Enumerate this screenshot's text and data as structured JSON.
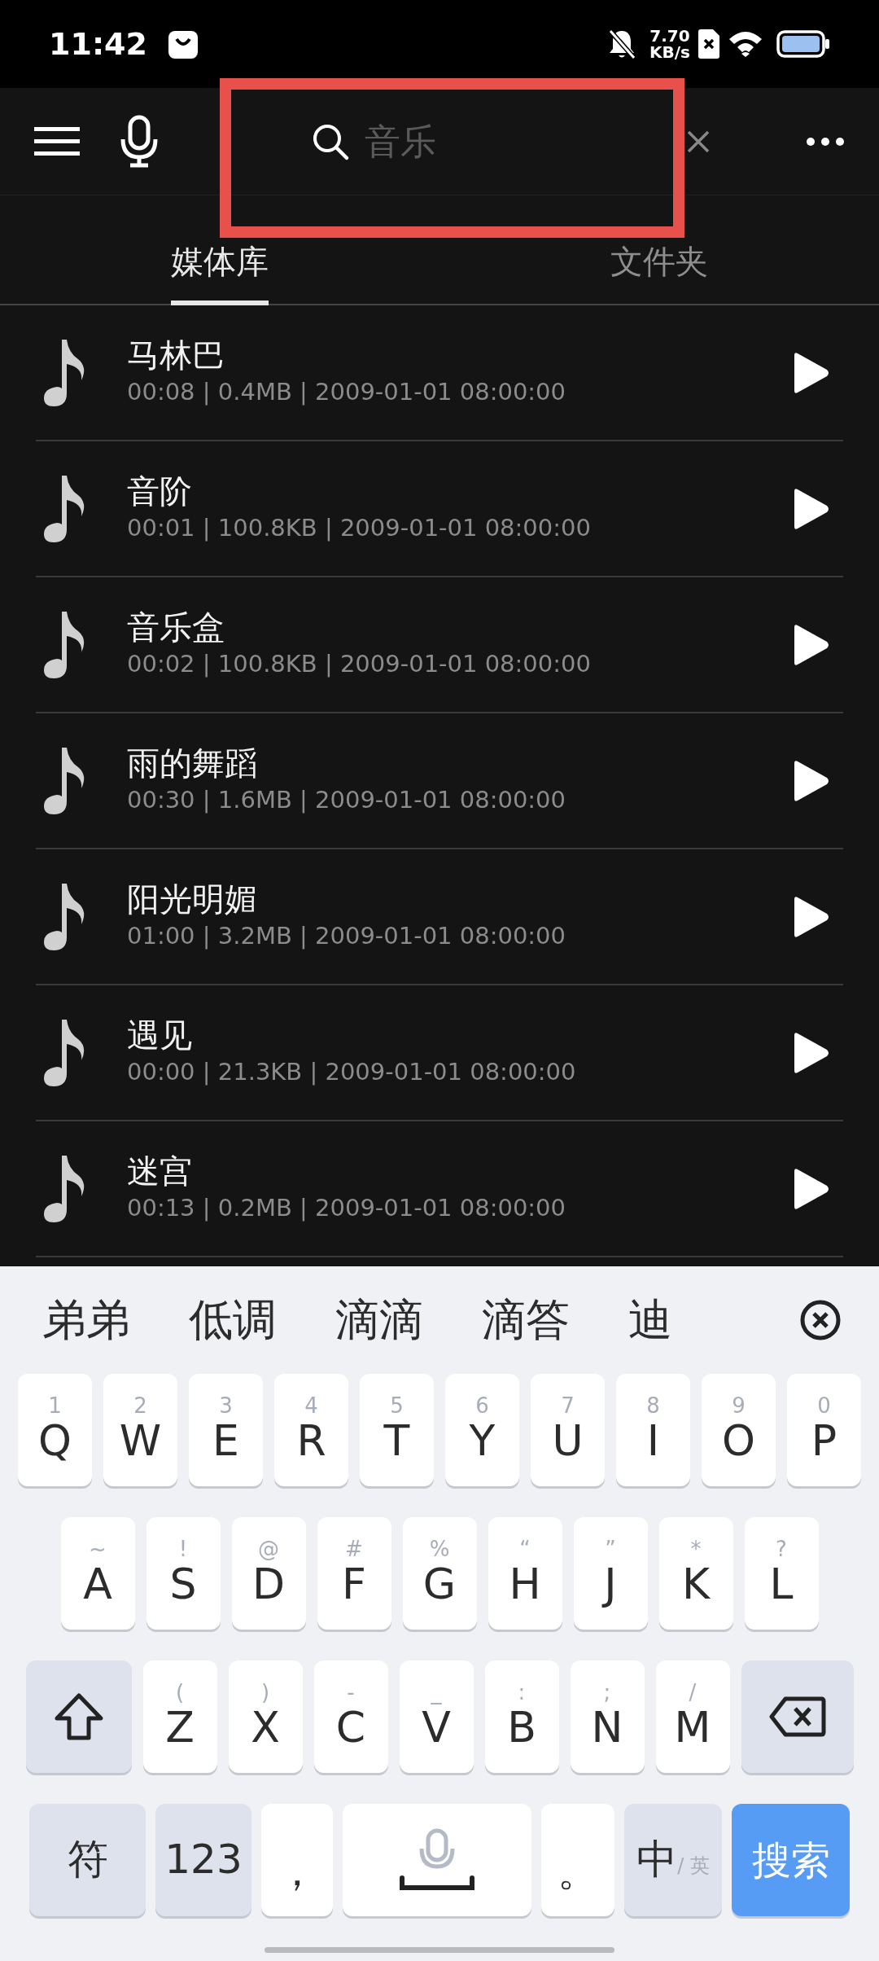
{
  "status_bar": {
    "time": "11:42",
    "net_speed_value": "7.70",
    "net_speed_unit": "KB/s"
  },
  "search": {
    "placeholder": "音乐"
  },
  "tabs": [
    {
      "label": "媒体库",
      "selected": true
    },
    {
      "label": "文件夹",
      "selected": false
    }
  ],
  "songs": [
    {
      "title": "马林巴",
      "meta": "00:08 | 0.4MB | 2009-01-01 08:00:00"
    },
    {
      "title": "音阶",
      "meta": "00:01 | 100.8KB | 2009-01-01 08:00:00"
    },
    {
      "title": "音乐盒",
      "meta": "00:02 | 100.8KB | 2009-01-01 08:00:00"
    },
    {
      "title": "雨的舞蹈",
      "meta": "00:30 | 1.6MB | 2009-01-01 08:00:00"
    },
    {
      "title": "阳光明媚",
      "meta": "01:00 | 3.2MB | 2009-01-01 08:00:00"
    },
    {
      "title": "遇见",
      "meta": "00:00 | 21.3KB | 2009-01-01 08:00:00"
    },
    {
      "title": "迷宫",
      "meta": "00:13 | 0.2MB | 2009-01-01 08:00:00"
    }
  ],
  "keyboard": {
    "candidates": [
      "弟弟",
      "低调",
      "滴滴",
      "滴答",
      "迪"
    ],
    "rows": [
      [
        {
          "kind": "letter",
          "label": "Q",
          "hint": "1"
        },
        {
          "kind": "letter",
          "label": "W",
          "hint": "2"
        },
        {
          "kind": "letter",
          "label": "E",
          "hint": "3"
        },
        {
          "kind": "letter",
          "label": "R",
          "hint": "4"
        },
        {
          "kind": "letter",
          "label": "T",
          "hint": "5"
        },
        {
          "kind": "letter",
          "label": "Y",
          "hint": "6"
        },
        {
          "kind": "letter",
          "label": "U",
          "hint": "7"
        },
        {
          "kind": "letter",
          "label": "I",
          "hint": "8"
        },
        {
          "kind": "letter",
          "label": "O",
          "hint": "9"
        },
        {
          "kind": "letter",
          "label": "P",
          "hint": "0"
        }
      ],
      [
        {
          "kind": "letter",
          "label": "A",
          "hint": "~"
        },
        {
          "kind": "letter",
          "label": "S",
          "hint": "!"
        },
        {
          "kind": "letter",
          "label": "D",
          "hint": "@"
        },
        {
          "kind": "letter",
          "label": "F",
          "hint": "#"
        },
        {
          "kind": "letter",
          "label": "G",
          "hint": "%"
        },
        {
          "kind": "letter",
          "label": "H",
          "hint": "“"
        },
        {
          "kind": "letter",
          "label": "J",
          "hint": "”"
        },
        {
          "kind": "letter",
          "label": "K",
          "hint": "*"
        },
        {
          "kind": "letter",
          "label": "L",
          "hint": "?"
        }
      ],
      [
        {
          "kind": "shift"
        },
        {
          "kind": "letter",
          "label": "Z",
          "hint": "("
        },
        {
          "kind": "letter",
          "label": "X",
          "hint": ")"
        },
        {
          "kind": "letter",
          "label": "C",
          "hint": "-"
        },
        {
          "kind": "letter",
          "label": "V",
          "hint": "_"
        },
        {
          "kind": "letter",
          "label": "B",
          "hint": ":"
        },
        {
          "kind": "letter",
          "label": "N",
          "hint": ";"
        },
        {
          "kind": "letter",
          "label": "M",
          "hint": "/"
        },
        {
          "kind": "backspace"
        }
      ]
    ],
    "bottom_row": [
      {
        "kind": "function",
        "label": "符"
      },
      {
        "kind": "function",
        "label": "123"
      },
      {
        "kind": "punct",
        "label": "，"
      },
      {
        "kind": "space"
      },
      {
        "kind": "punct",
        "label": "。"
      },
      {
        "kind": "lang",
        "label": "中",
        "hint": "/ 英"
      },
      {
        "kind": "enter",
        "label": "搜索"
      }
    ]
  }
}
